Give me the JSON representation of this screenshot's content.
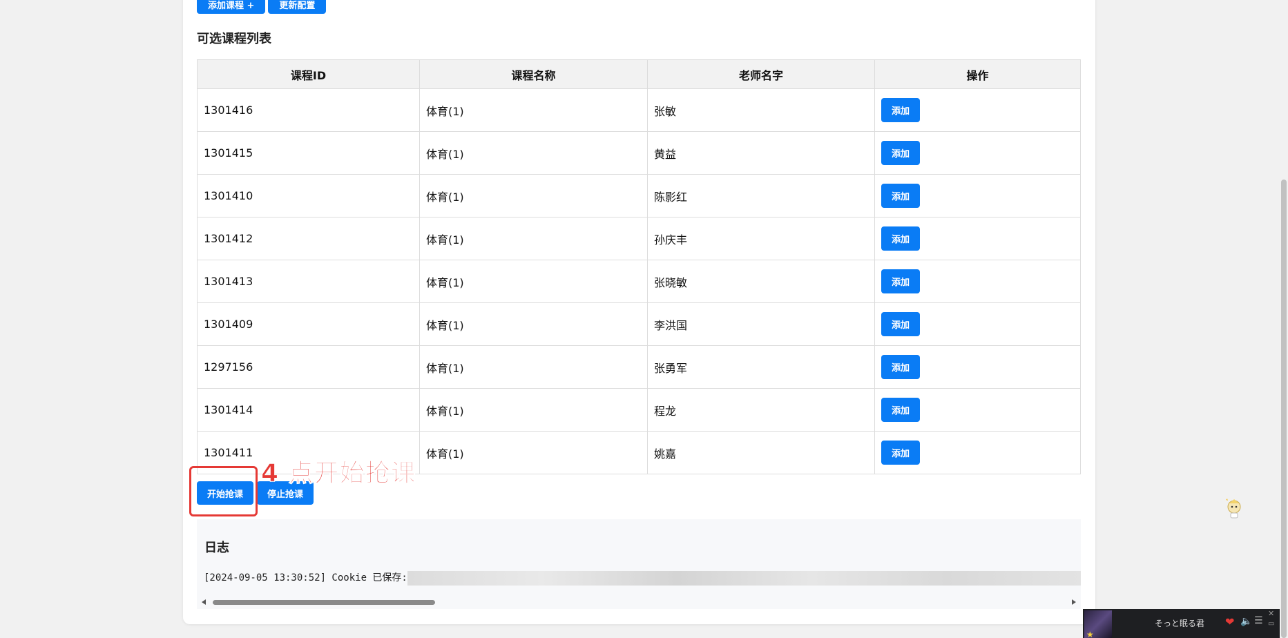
{
  "top_buttons": {
    "add_course": "添加课程 +",
    "update_config": "更新配置"
  },
  "section_title": "可选课程列表",
  "table": {
    "headers": [
      "课程ID",
      "课程名称",
      "老师名字",
      "操作"
    ],
    "rows": [
      {
        "id": "1301416",
        "name": "体育(1)",
        "teacher": "张敏",
        "action": "添加"
      },
      {
        "id": "1301415",
        "name": "体育(1)",
        "teacher": "黄益",
        "action": "添加"
      },
      {
        "id": "1301410",
        "name": "体育(1)",
        "teacher": "陈影红",
        "action": "添加"
      },
      {
        "id": "1301412",
        "name": "体育(1)",
        "teacher": "孙庆丰",
        "action": "添加"
      },
      {
        "id": "1301413",
        "name": "体育(1)",
        "teacher": "张晓敏",
        "action": "添加"
      },
      {
        "id": "1301409",
        "name": "体育(1)",
        "teacher": "李洪国",
        "action": "添加"
      },
      {
        "id": "1297156",
        "name": "体育(1)",
        "teacher": "张勇军",
        "action": "添加"
      },
      {
        "id": "1301414",
        "name": "体育(1)",
        "teacher": "程龙",
        "action": "添加"
      },
      {
        "id": "1301411",
        "name": "体育(1)",
        "teacher": "姚嘉",
        "action": "添加"
      }
    ]
  },
  "actions": {
    "start": "开始抢课",
    "stop": "停止抢课"
  },
  "annotation": "4 点开始抢课",
  "log": {
    "title": "日志",
    "line": "[2024-09-05 13:30:52] Cookie 已保存:"
  },
  "music_player": {
    "song": "そっと眠る君",
    "icons": [
      "album-cover-icon",
      "heart-icon",
      "volume-icon",
      "playlist-icon",
      "close-icon",
      "minimize-icon"
    ]
  },
  "colors": {
    "primary": "#0a7cf5",
    "annotation": "#e53935",
    "header_bg": "#f2f2f2"
  }
}
